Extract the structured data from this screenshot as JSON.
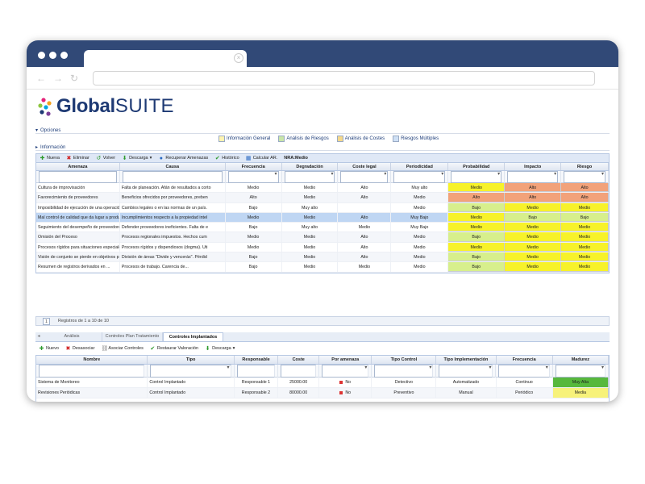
{
  "app": {
    "brand_part1": "Global",
    "brand_part2": "SUITE"
  },
  "sections": {
    "opciones": "Opciones",
    "informacion": "Información"
  },
  "options": [
    {
      "label": "Información General",
      "icon": "edit-icon"
    },
    {
      "label": "Análisis de Riesgos",
      "icon": "chart-icon"
    },
    {
      "label": "Análisis de Costes",
      "icon": "coins-icon"
    },
    {
      "label": "Riesgos Múltiples",
      "icon": "grid-icon"
    }
  ],
  "toolbar": {
    "nueva": "Nueva",
    "eliminar": "Eliminar",
    "volver": "Volver",
    "descarga": "Descarga",
    "recuperar": "Recuperar Amenazas",
    "historico": "Histórico",
    "calcular": "Calcular AR.",
    "nra": "NRA:Medio"
  },
  "grid": {
    "headers": [
      "Amenaza",
      "Causa",
      "Frecuencia",
      "Degradación",
      "Coste legal",
      "Periodicidad",
      "Probabilidad",
      "Impacto",
      "Riesgo"
    ],
    "rows": [
      [
        "Cultura de improvisación",
        "Falta de planeación. Afán de resultados a corto",
        "Medio",
        "Medio",
        "Alto",
        "Muy alto",
        "Medio",
        "Alto",
        "Alto"
      ],
      [
        "Favorecimiento de proveedores",
        "Beneficios ofrecidos por proveedores, preben",
        "Alto",
        "Medio",
        "Alto",
        "Medio",
        "Alto",
        "Alto",
        "Alto"
      ],
      [
        "Imposibilidad de ejecución de una operación",
        "Cambios legales o en las normas de un país.",
        "Bajo",
        "Muy alto",
        "",
        "Medio",
        "Bajo",
        "Medio",
        "Medio"
      ],
      [
        "Mal control de calidad que da lugar a productos",
        "Incumplimientos respecto a la propiedad intel",
        "Medio",
        "Medio",
        "Alto",
        "Muy Bajo",
        "Medio",
        "Bajo",
        "Bajo"
      ],
      [
        "Seguimiento del desempeño de proveedores",
        "Defender proveedores ineficientes. Falta de e",
        "Bajo",
        "Muy alto",
        "Medio",
        "Muy Bajo",
        "Medio",
        "Medio",
        "Medio"
      ],
      [
        "Omisión del Proceso",
        "Procesos regionales impuestos. Hechos cum",
        "Medio",
        "Medio",
        "Alto",
        "Medio",
        "Bajo",
        "Medio",
        "Medio"
      ],
      [
        "Procesos rígidos para situaciones especiales",
        "Procesos rígidos y dispendiosos (dogma). Uti",
        "Medio",
        "Medio",
        "Alto",
        "Medio",
        "Medio",
        "Medio",
        "Medio"
      ],
      [
        "Visión de conjunto se pierde en objetivos par",
        "División de áreas \"Divide y vencerás\". Pérdid",
        "Bajo",
        "Medio",
        "Alto",
        "Medio",
        "Bajo",
        "Medio",
        "Medio"
      ],
      [
        "Resumen de registros derivados en ...",
        "Procesos de trabajo. Carencia de...",
        "Bajo",
        "Medio",
        "Medio",
        "Medio",
        "Bajo",
        "Medio",
        "Medio"
      ]
    ]
  },
  "pager": {
    "page": "1",
    "summary": "Registros de 1 a 10 de 10"
  },
  "subtabs": [
    "Análisis",
    "Controles Plan Tratamiento",
    "Controles Implantados"
  ],
  "toolbar2": {
    "nuevo": "Nuevo",
    "desasociar": "Desasociar",
    "asociar": "Asociar Controles",
    "restaurar": "Restaurar Valoración",
    "descarga": "Descarga"
  },
  "grid2": {
    "headers": [
      "Nombre",
      "Tipo",
      "Responsable",
      "Coste",
      "Por amenaza",
      "Tipo Control",
      "Tipo Implementación",
      "Frecuencia",
      "Madurez"
    ],
    "rows": [
      [
        "Sistema de Monitoreo",
        "Control Implantado",
        "Responsable 1",
        "25000.00",
        "No",
        "Detectivo",
        "Automatizado",
        "Continuo",
        "Muy Alta"
      ],
      [
        "Revisiones Periódicas",
        "Control Implantado",
        "Responsable 2",
        "80000.00",
        "No",
        "Preventivo",
        "Manual",
        "Periódico",
        "Media"
      ]
    ]
  },
  "colors": {
    "titlebar": "#314977",
    "level_alto": "#f2a27a",
    "level_medio": "#f7f22a",
    "level_bajo": "#d7ef8c",
    "madurez_muy_alta": "#57b83c",
    "madurez_media": "#f7f27a"
  }
}
